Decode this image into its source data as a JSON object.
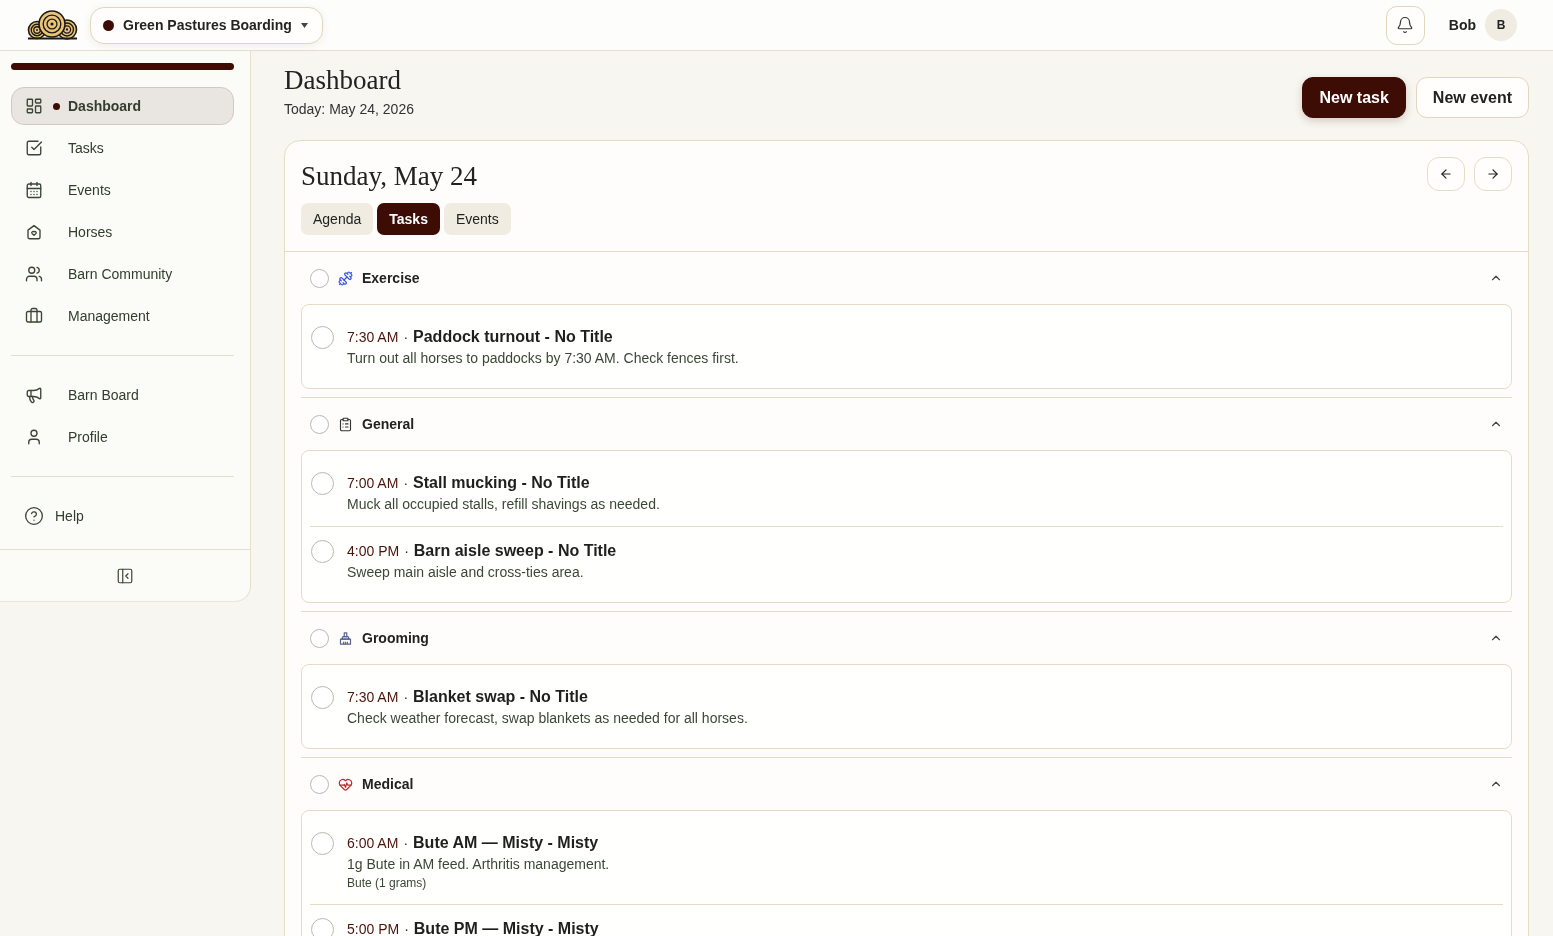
{
  "top_bar": {
    "barn_selector": {
      "label": "Green Pastures Boarding"
    },
    "user": {
      "name": "Bob",
      "initial": "B"
    }
  },
  "sidebar": {
    "main_nav": [
      {
        "label": "Dashboard",
        "selected": true
      },
      {
        "label": "Tasks",
        "selected": false
      },
      {
        "label": "Events",
        "selected": false
      },
      {
        "label": "Horses",
        "selected": false
      },
      {
        "label": "Barn Community",
        "selected": false
      },
      {
        "label": "Management",
        "selected": false
      }
    ],
    "secondary_nav": [
      {
        "label": "Barn Board",
        "selected": false
      },
      {
        "label": "Profile",
        "selected": false
      }
    ],
    "help": {
      "label": "Help"
    }
  },
  "page": {
    "title": "Dashboard",
    "subtitle": "Today: May 24, 2026",
    "actions": [
      {
        "label": "New task",
        "kind": "primary"
      },
      {
        "label": "New event",
        "kind": "secondary"
      }
    ]
  },
  "day_card": {
    "title": "Sunday, May 24",
    "tabs": [
      {
        "label": "Agenda",
        "selected": false
      },
      {
        "label": "Tasks",
        "selected": true
      },
      {
        "label": "Events",
        "selected": false
      }
    ],
    "categories": [
      {
        "name": "Exercise",
        "checked": false,
        "expanded": true,
        "tasks": [
          {
            "time": "7:30 AM",
            "separator": "·",
            "title": "Paddock turnout - No Title",
            "description": "Turn out all horses to paddocks by 7:30 AM. Check fences first.",
            "checked": false
          }
        ]
      },
      {
        "name": "General",
        "checked": false,
        "expanded": true,
        "tasks": [
          {
            "time": "7:00 AM",
            "separator": "·",
            "title": "Stall mucking - No Title",
            "description": "Muck all occupied stalls, refill shavings as needed.",
            "checked": false
          },
          {
            "time": "4:00 PM",
            "separator": "·",
            "title": "Barn aisle sweep - No Title",
            "description": "Sweep main aisle and cross-ties area.",
            "checked": false
          }
        ]
      },
      {
        "name": "Grooming",
        "checked": false,
        "expanded": true,
        "tasks": [
          {
            "time": "7:30 AM",
            "separator": "·",
            "title": "Blanket swap - No Title",
            "description": "Check weather forecast, swap blankets as needed for all horses.",
            "checked": false
          }
        ]
      },
      {
        "name": "Medical",
        "checked": false,
        "expanded": true,
        "tasks": [
          {
            "time": "6:00 AM",
            "separator": "·",
            "title": "Bute AM — Misty - Misty",
            "description": "1g Bute in AM feed. Arthritis management.",
            "note": "Bute (1 grams)",
            "checked": false
          },
          {
            "time": "5:00 PM",
            "separator": "·",
            "title": "Bute PM — Misty - Misty",
            "checked": false
          }
        ]
      }
    ]
  }
}
